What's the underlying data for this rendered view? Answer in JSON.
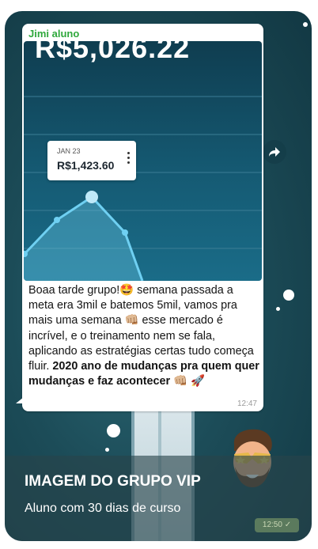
{
  "message": {
    "sender": "Jimi aluno",
    "time": "12:47",
    "text_part1": "Boaa tarde grupo!🤩 semana passada a meta era 3mil e batemos 5mil, vamos pra mais uma semana 👊🏼 esse mercado é incrível, e o treinamento nem se fala, aplicando as estratégias certas tudo começa fluir. ",
    "text_bold": "2020 ano de mudanças pra quem quer mudanças e faz acontecer",
    "text_part3": " 👊🏼 🚀"
  },
  "screenshot_image": {
    "balance": "R$5,026.22",
    "tooltip_date": "JAN 23",
    "tooltip_value": "R$1,423.60"
  },
  "overlay": {
    "title": "IMAGEM DO GRUPO VIP",
    "subtitle": "Aluno com 30 dias de curso",
    "time": "12:50 ✓"
  },
  "colors": {
    "sender": "#2fa83c",
    "chart_line": "#6fd0f2",
    "background": "#1c4c58"
  }
}
